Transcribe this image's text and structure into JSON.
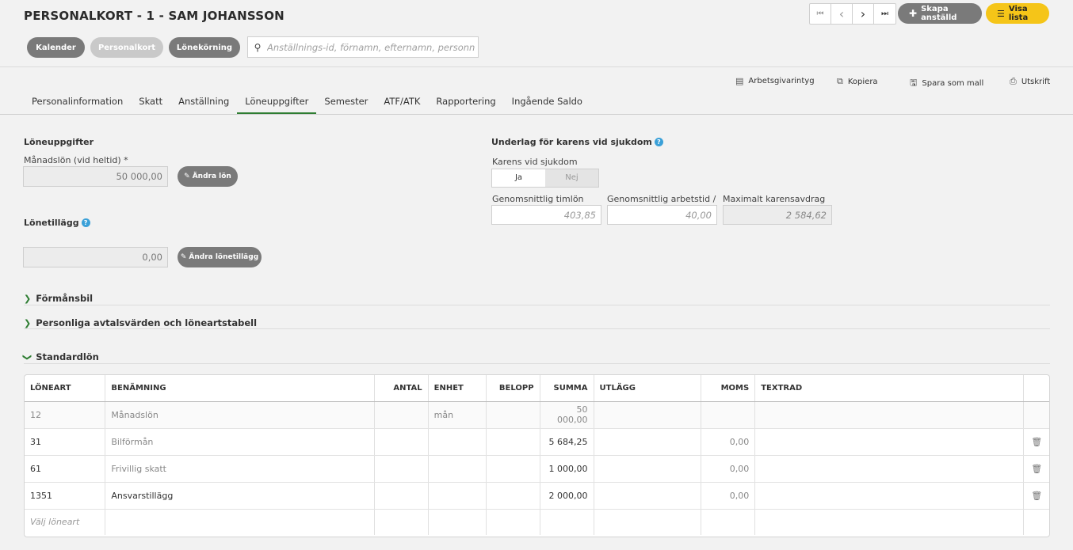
{
  "page_title": "PERSONALKORT - 1 - SAM JOHANSSON",
  "nav": {
    "first": "⏮",
    "prev": "‹",
    "next": "›",
    "last": "⏭"
  },
  "header_buttons": {
    "create": "Skapa anställd",
    "list": "Visa lista"
  },
  "top_tabs": {
    "calendar": "Kalender",
    "personnel_card": "Personalkort",
    "payroll": "Lönekörning"
  },
  "search": {
    "placeholder": "Anställnings-id, förnamn, efternamn, personnr"
  },
  "actions": {
    "employer_cert": "Arbetsgivarintyg",
    "copy": "Kopiera",
    "save_template": "Spara som mall",
    "print": "Utskrift"
  },
  "tabs": [
    "Personalinformation",
    "Skatt",
    "Anställning",
    "Löneuppgifter",
    "Semester",
    "ATF/ATK",
    "Rapportering",
    "Ingående Saldo"
  ],
  "active_tab": "Löneuppgifter",
  "salary": {
    "section_title": "Löneuppgifter",
    "monthly_label": "Månadslön (vid heltid) *",
    "monthly_value": "50 000,00",
    "change_salary_btn": "Ändra lön",
    "supplement_title": "Lönetillägg",
    "supplement_value": "0,00",
    "change_supplement_btn": "Ändra lönetillägg"
  },
  "sick": {
    "section_title": "Underlag för karens vid sjukdom",
    "karens_label": "Karens vid sjukdom",
    "yes": "Ja",
    "no": "Nej",
    "avg_hourly_label": "Genomsnittlig timlön",
    "avg_hourly_value": "403,85",
    "avg_worktime_label": "Genomsnittlig arbetstid /",
    "avg_worktime_value": "40,00",
    "max_deduction_label": "Maximalt karensavdrag",
    "max_deduction_value": "2 584,62"
  },
  "collapsibles": {
    "benefit_car": "Förmånsbil",
    "personal_agreements": "Personliga avtalsvärden och löneartstabell",
    "standard_salary": "Standardlön"
  },
  "table": {
    "headers": {
      "loneart": "LÖNEART",
      "benamning": "BENÄMNING",
      "antal": "ANTAL",
      "enhet": "ENHET",
      "belopp": "BELOPP",
      "summa": "SUMMA",
      "utlagg": "UTLÄGG",
      "moms": "MOMS",
      "textrad": "TEXTRAD"
    },
    "rows": [
      {
        "loneart": "12",
        "benamning": "Månadslön",
        "antal": "",
        "enhet": "mån",
        "belopp": "",
        "summa": "50 000,00",
        "utlagg": "",
        "moms": "",
        "textrad": ""
      },
      {
        "loneart": "31",
        "benamning": "Bilförmån",
        "antal": "",
        "enhet": "",
        "belopp": "",
        "summa": "5 684,25",
        "utlagg": "",
        "moms": "0,00",
        "textrad": ""
      },
      {
        "loneart": "61",
        "benamning": "Frivillig skatt",
        "antal": "",
        "enhet": "",
        "belopp": "",
        "summa": "1 000,00",
        "utlagg": "",
        "moms": "0,00",
        "textrad": ""
      },
      {
        "loneart": "1351",
        "benamning": "Ansvarstillägg",
        "antal": "",
        "enhet": "",
        "belopp": "",
        "summa": "2 000,00",
        "utlagg": "",
        "moms": "0,00",
        "textrad": ""
      }
    ],
    "new_row_placeholder": "Välj löneart"
  }
}
